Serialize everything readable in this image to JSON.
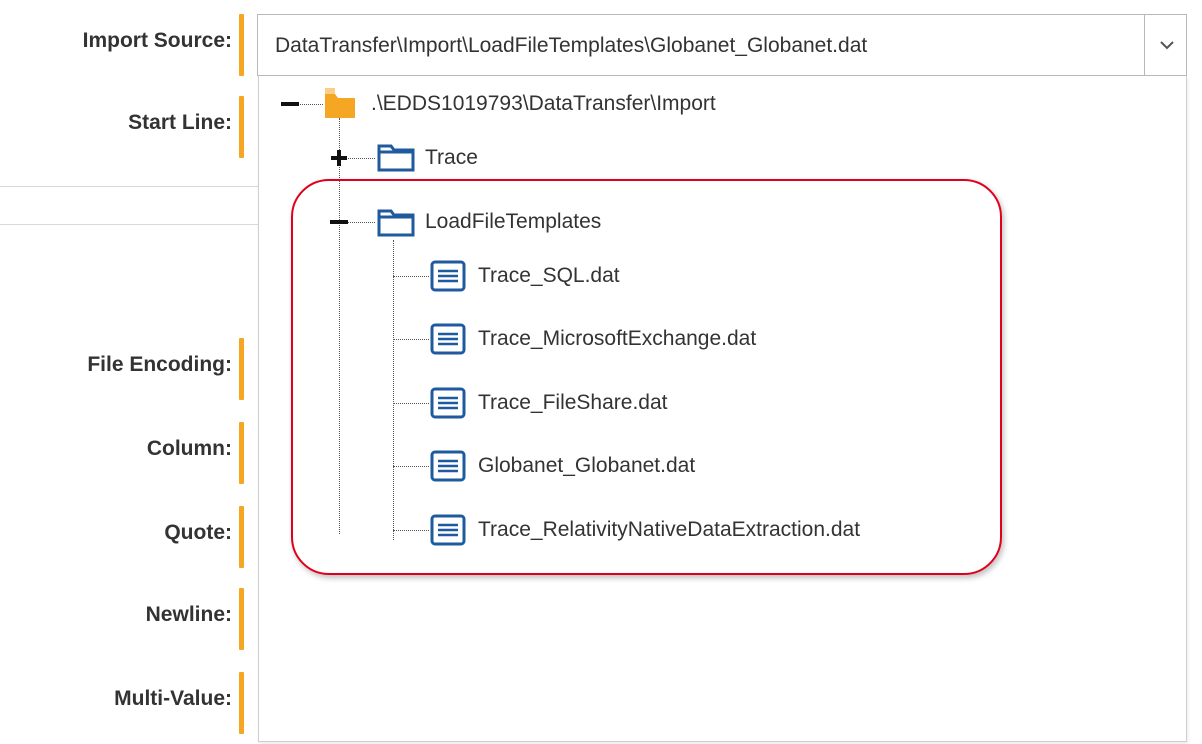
{
  "form": {
    "labels": {
      "import_source": "Import Source:",
      "start_line": "Start Line:",
      "file_encoding": "File Encoding:",
      "column": "Column:",
      "quote": "Quote:",
      "newline": "Newline:",
      "multi_value": "Multi-Value:"
    },
    "required_color": "#f5a623"
  },
  "import_source": {
    "selected_value": "DataTransfer\\Import\\LoadFileTemplates\\Globanet_Globanet.dat",
    "chevron_icon": "chevron-down-icon"
  },
  "tree": {
    "root": {
      "label": ".\\EDDS1019793\\DataTransfer\\Import",
      "icon": "folder-open-icon",
      "expanded": true
    },
    "trace": {
      "label": "Trace",
      "icon": "folder-icon",
      "expanded": false
    },
    "load_file_templates": {
      "label": "LoadFileTemplates",
      "icon": "folder-icon",
      "expanded": true,
      "files": [
        "Trace_SQL.dat",
        "Trace_MicrosoftExchange.dat",
        "Trace_FileShare.dat",
        "Globanet_Globanet.dat",
        "Trace_RelativityNativeDataExtraction.dat"
      ],
      "file_icon": "file-text-icon"
    }
  },
  "colors": {
    "highlight": "#e0001b",
    "folder_outline": "#1f5a9e",
    "open_folder": "#f5a623",
    "accent_bar": "#f5a623"
  }
}
